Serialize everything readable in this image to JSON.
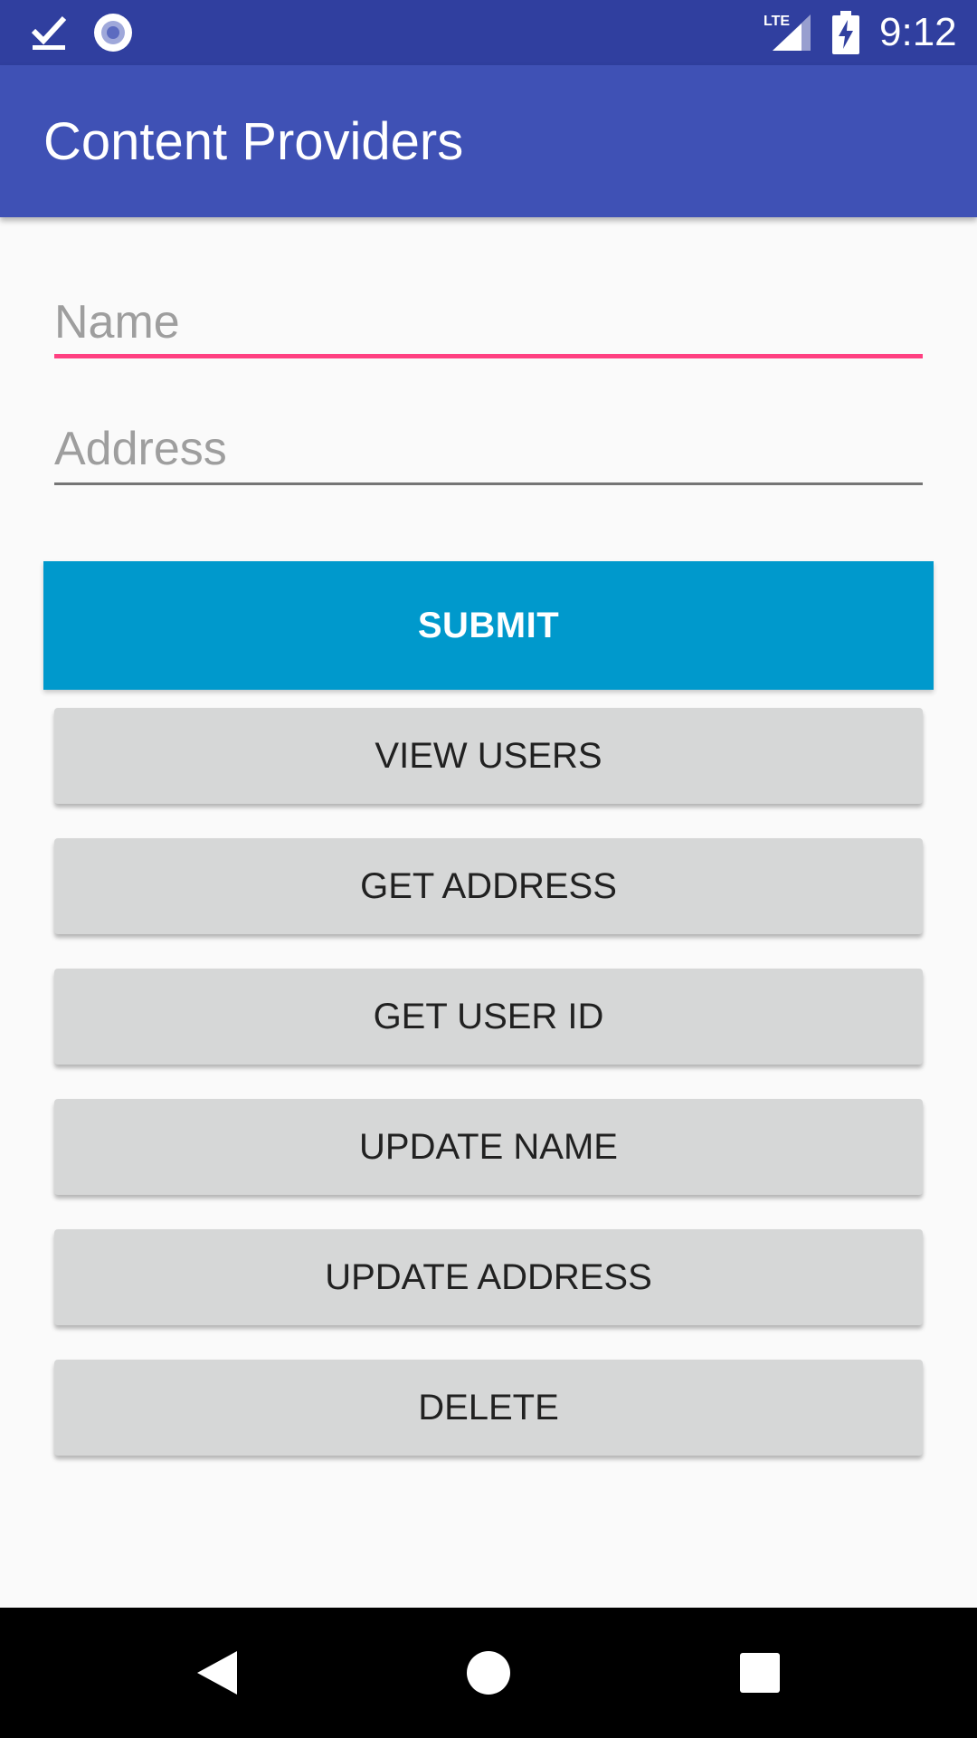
{
  "status_bar": {
    "time": "9:12",
    "network_label": "LTE",
    "icons": [
      "checkmark-notification-icon",
      "circle-notification-icon",
      "lte-signal-icon",
      "battery-charging-icon"
    ]
  },
  "app_bar": {
    "title": "Content Providers",
    "color": "#3f51b5"
  },
  "form": {
    "name_placeholder": "Name",
    "name_value": "",
    "address_placeholder": "Address",
    "address_value": "",
    "accent_color": "#ff4081"
  },
  "buttons": {
    "submit": "SUBMIT",
    "submit_color": "#0099cc",
    "view_users": "VIEW USERS",
    "get_address": "GET ADDRESS",
    "get_user_id": "GET USER ID",
    "update_name": "UPDATE NAME",
    "update_address": "UPDATE ADDRESS",
    "delete": "DELETE"
  },
  "nav_bar": {
    "icons": [
      "back-icon",
      "home-icon",
      "recents-icon"
    ]
  }
}
